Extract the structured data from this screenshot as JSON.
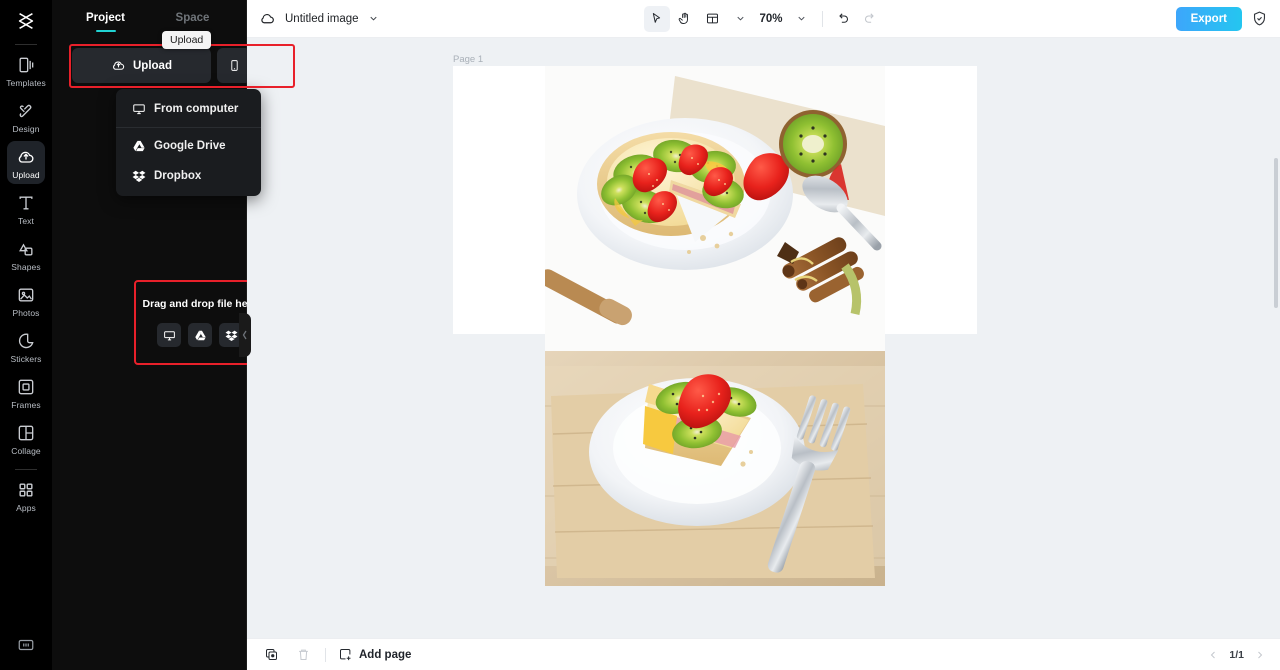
{
  "app": {
    "logo_icon": "capcut-logo-icon"
  },
  "rail": {
    "items": [
      {
        "label": "Templates",
        "icon": "templates-icon",
        "active": false
      },
      {
        "label": "Design",
        "icon": "design-icon",
        "active": false
      },
      {
        "label": "Upload",
        "icon": "upload-cloud-icon",
        "active": true
      },
      {
        "label": "Text",
        "icon": "text-icon",
        "active": false
      },
      {
        "label": "Shapes",
        "icon": "shapes-icon",
        "active": false
      },
      {
        "label": "Photos",
        "icon": "photos-icon",
        "active": false
      },
      {
        "label": "Stickers",
        "icon": "stickers-icon",
        "active": false
      },
      {
        "label": "Frames",
        "icon": "frames-icon",
        "active": false
      },
      {
        "label": "Collage",
        "icon": "collage-icon",
        "active": false
      },
      {
        "label": "Apps",
        "icon": "apps-grid-icon",
        "active": false
      }
    ],
    "bottom_icon": "panel-toggle-icon"
  },
  "panel": {
    "tabs": [
      {
        "label": "Project",
        "active": true
      },
      {
        "label": "Space",
        "active": false
      }
    ],
    "tooltip": "Upload",
    "upload_button": {
      "label": "Upload",
      "icon": "upload-cloud-icon"
    },
    "mobile_button": {
      "icon": "mobile-phone-icon"
    },
    "menu": [
      {
        "label": "From computer",
        "icon": "monitor-icon"
      },
      {
        "label": "Google Drive",
        "icon": "google-drive-icon"
      },
      {
        "label": "Dropbox",
        "icon": "dropbox-icon"
      }
    ],
    "drop_zone": {
      "text": "Drag and drop file here",
      "buttons": [
        {
          "icon": "monitor-icon"
        },
        {
          "icon": "google-drive-icon"
        },
        {
          "icon": "dropbox-icon"
        }
      ]
    },
    "highlight_color": "#e8202a"
  },
  "topbar": {
    "doc_icon": "cloud-icon",
    "doc_title": "Untitled image",
    "doc_caret": "chevron-down-icon",
    "tools": [
      {
        "icon": "cursor-select-icon",
        "selected": true
      },
      {
        "icon": "hand-pan-icon",
        "selected": false
      },
      {
        "icon": "layout-grid-icon",
        "selected": false
      },
      {
        "icon": "chevron-down-icon",
        "selected": false
      }
    ],
    "zoom_level": "70%",
    "zoom_caret": "chevron-down-icon",
    "undo_icon": "undo-icon",
    "redo_icon": "redo-icon",
    "export_label": "Export",
    "shield_icon": "shield-check-icon",
    "export_color": "#3da6fb"
  },
  "canvas": {
    "page_label": "Page 1",
    "image_alt": "fruit-tart-photo"
  },
  "bottombar": {
    "duplicate_icon": "duplicate-page-icon",
    "delete_icon": "trash-icon",
    "add_page_label": "Add page",
    "add_page_icon": "add-page-icon",
    "prev_icon": "chevron-left-icon",
    "next_icon": "chevron-right-icon",
    "page_indicator": "1/1"
  }
}
